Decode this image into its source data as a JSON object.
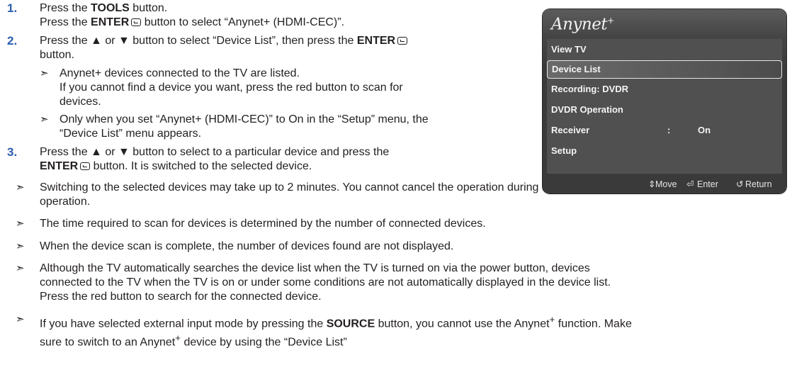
{
  "steps": [
    {
      "number": "1.",
      "lines": [
        {
          "pre": "Press the ",
          "bold": "TOOLS",
          "post": " button."
        },
        {
          "pre": "Press the ",
          "bold": "ENTER",
          "enter_icon": true,
          "post": " button to select “Anynet+ (HDMI-CEC)”."
        }
      ]
    },
    {
      "number": "2.",
      "line1_pre": "Press the ▲ or ▼ button to select “Device List”, then press the ",
      "line1_bold": "ENTER",
      "line2": "button.",
      "notes": [
        {
          "l1": "Anynet+ devices connected to the TV are listed.",
          "l2": "If you cannot find a device you want, press the red button to scan for",
          "l3": "devices."
        },
        {
          "l1": "Only when you set “Anynet+ (HDMI-CEC)” to On in the “Setup” menu, the",
          "l2": "“Device List” menu appears."
        }
      ]
    },
    {
      "number": "3.",
      "line1": "Press the ▲ or ▼ button to select to a particular device and press the",
      "line2_bold": "ENTER",
      "line2_post": " button. It is switched to the selected device."
    }
  ],
  "notes": [
    {
      "l1": "Switching to the selected devices may take up to 2 minutes. You cannot cancel the operation during the switching",
      "l2": "operation."
    },
    {
      "l1": "The time required to scan for devices is determined by the number of connected devices."
    },
    {
      "l1": "When the device scan is complete, the number of devices found are not displayed."
    },
    {
      "l1": "Although the TV automatically searches the device list when the TV is turned on via the power button, devices",
      "l2": "connected to the TV when the TV is on or under some conditions are not automatically displayed in the device list.",
      "l3": "Press the red button to search for the connected device."
    },
    {
      "l1_pre": "If you have selected external input mode by pressing the ",
      "l1_bold": "SOURCE",
      "l1_mid": " button, you cannot use the Anynet",
      "l1_sup": "+",
      "l1_post": " function. Make",
      "l2_pre": "sure to switch to an Anynet",
      "l2_sup": "+",
      "l2_post": " device by using the “Device List”"
    }
  ],
  "bullet_symbol": "➣",
  "osd": {
    "logo": "Anynet",
    "logo_sup": "+",
    "items": [
      {
        "label": "View TV"
      },
      {
        "label": "Device List",
        "selected": true
      },
      {
        "label": "Recording: DVDR"
      },
      {
        "label": "DVDR Operation"
      },
      {
        "label": "Receiver",
        "colon": ":",
        "value": "On"
      },
      {
        "label": "Setup"
      }
    ],
    "footer": {
      "move": "Move",
      "enter": "Enter",
      "return": "Return",
      "move_icon": "updown-icon",
      "enter_icon": "enter-icon",
      "return_icon": "return-icon"
    }
  }
}
